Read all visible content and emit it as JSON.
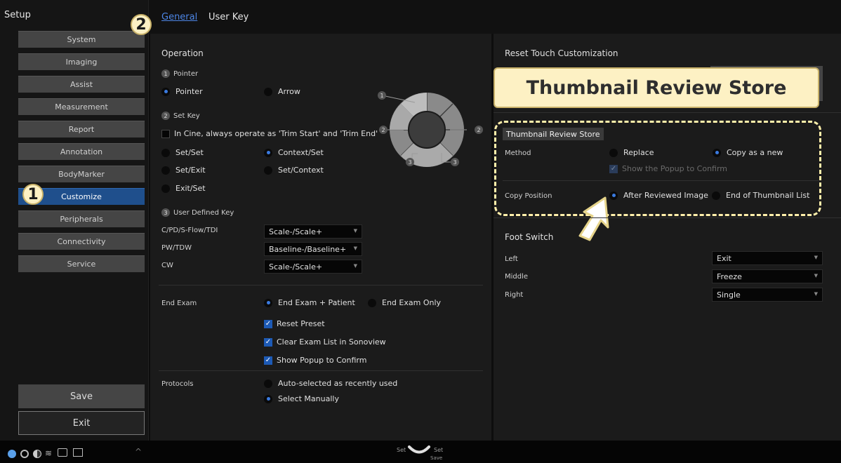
{
  "sidebar": {
    "title": "Setup",
    "items": [
      {
        "label": "System",
        "active": false
      },
      {
        "label": "Imaging",
        "active": false
      },
      {
        "label": "Assist",
        "active": false
      },
      {
        "label": "Measurement",
        "active": false
      },
      {
        "label": "Report",
        "active": false
      },
      {
        "label": "Annotation",
        "active": false
      },
      {
        "label": "BodyMarker",
        "active": false
      },
      {
        "label": "Customize",
        "active": true
      },
      {
        "label": "Peripherals",
        "active": false
      },
      {
        "label": "Connectivity",
        "active": false
      },
      {
        "label": "Service",
        "active": false
      }
    ],
    "save_label": "Save",
    "exit_label": "Exit"
  },
  "tabs": [
    {
      "label": "General",
      "active": true
    },
    {
      "label": "User Key",
      "active": false
    }
  ],
  "markers": {
    "one": "1",
    "two": "2"
  },
  "operation": {
    "title": "Operation",
    "pointer": {
      "num": "1",
      "label": "Pointer",
      "options": [
        {
          "label": "Pointer",
          "selected": true
        },
        {
          "label": "Arrow",
          "selected": false
        }
      ]
    },
    "set_key": {
      "num": "2",
      "label": "Set Key",
      "cine_check": {
        "label": "In Cine, always operate as 'Trim Start' and 'Trim End'",
        "checked": false
      },
      "options": [
        {
          "label": "Set/Set",
          "selected": false
        },
        {
          "label": "Context/Set",
          "selected": true
        },
        {
          "label": "Set/Exit",
          "selected": false
        },
        {
          "label": "Set/Context",
          "selected": false
        },
        {
          "label": "Exit/Set",
          "selected": false
        }
      ]
    },
    "user_defined_key": {
      "num": "3",
      "label": "User Defined Key",
      "rows": [
        {
          "label": "C/PD/S-Flow/TDI",
          "value": "Scale-/Scale+"
        },
        {
          "label": "PW/TDW",
          "value": "Baseline-/Baseline+"
        },
        {
          "label": "CW",
          "value": "Scale-/Scale+"
        }
      ]
    },
    "diagram_labels": {
      "one": "1",
      "two": "2",
      "three": "3"
    }
  },
  "end_exam": {
    "label": "End Exam",
    "options": [
      {
        "label": "End Exam + Patient",
        "selected": true
      },
      {
        "label": "End Exam Only",
        "selected": false
      }
    ],
    "checks": [
      {
        "label": "Reset Preset",
        "checked": true
      },
      {
        "label": "Clear Exam List in Sonoview",
        "checked": true
      },
      {
        "label": "Show Popup to Confirm",
        "checked": true
      }
    ]
  },
  "protocols": {
    "label": "Protocols",
    "options": [
      {
        "label": "Auto-selected as recently used",
        "selected": false
      },
      {
        "label": "Select Manually",
        "selected": true
      }
    ]
  },
  "right": {
    "reset_touch_title": "Reset Touch Customization",
    "callout": "Thumbnail Review Store",
    "thumbnail": {
      "title": "Thumbnail Review Store",
      "method_label": "Method",
      "method_options": [
        {
          "label": "Replace",
          "selected": false
        },
        {
          "label": "Copy as a new",
          "selected": true
        }
      ],
      "popup_check": {
        "label": "Show the Popup to Confirm",
        "checked": true,
        "disabled": true
      },
      "copy_position_label": "Copy Position",
      "copy_position_options": [
        {
          "label": "After Reviewed Image",
          "selected": true
        },
        {
          "label": "End of Thumbnail List",
          "selected": false
        }
      ]
    },
    "foot_switch": {
      "title": "Foot Switch",
      "rows": [
        {
          "label": "Left",
          "value": "Exit"
        },
        {
          "label": "Middle",
          "value": "Freeze"
        },
        {
          "label": "Right",
          "value": "Single"
        }
      ]
    }
  },
  "status_bar": {
    "set_left": "Set",
    "set_right": "Set",
    "save": "Save",
    "icons": [
      "user-icon",
      "shield-icon",
      "contrast-icon",
      "wifi-icon",
      "record-icon",
      "network-off-icon",
      "chevron-up-icon"
    ]
  },
  "colors": {
    "accent": "#3a7ae0",
    "active_nav": "#1f4f8c",
    "callout_bg": "#fdf1c4",
    "highlight": "#ffefaa"
  }
}
